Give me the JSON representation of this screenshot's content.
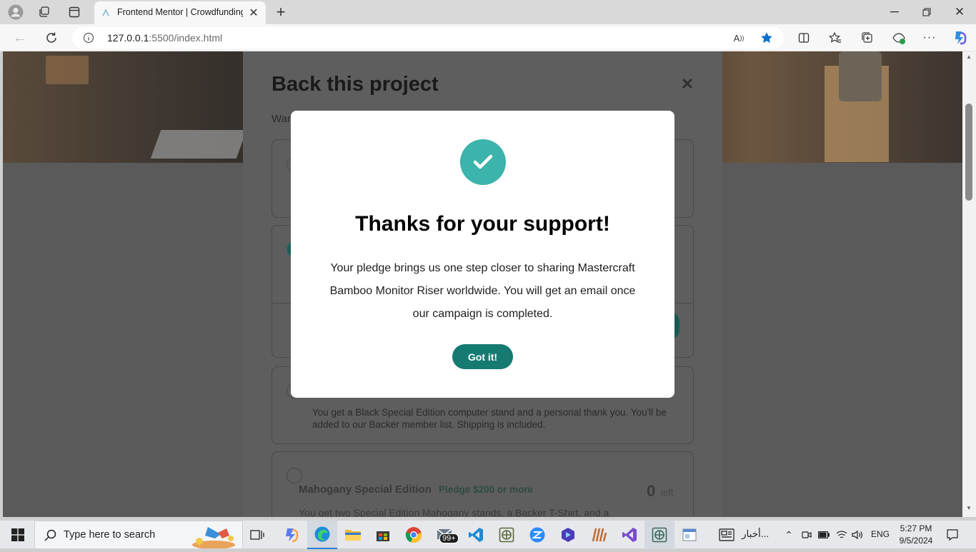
{
  "browser": {
    "tab_title": "Frontend Mentor | Crowdfunding",
    "url": "127.0.0.1:5500/index.html",
    "url_host": "127.0.0.1",
    "url_rest": ":5500/index.html"
  },
  "page": {
    "modal_title": "Back this project",
    "modal_intro": "Want to support us in bringing Mastercraft Bamboo Monitor Riser out in the world?",
    "visible_card_text": "You get a Black Special Edition computer stand and a personal thank you. You'll be added to our Backer member list. Shipping is included.",
    "mahogany_title": "Mahogany Special Edition",
    "mahogany_pledge": "Pledge $200 or more",
    "mahogany_left_num": "0",
    "mahogany_left_label": "left",
    "mahogany_desc": "You get two Special Edition Mahogany stands, a Backer T-Shirt, and a"
  },
  "success": {
    "title": "Thanks for your support!",
    "body": "Your pledge brings us one step closer to sharing Mastercraft Bamboo Monitor Riser worldwide. You will get an email once our campaign is completed.",
    "button": "Got it!"
  },
  "taskbar": {
    "search_placeholder": "Type here to search",
    "news_label": "أخبار...",
    "language": "ENG",
    "time": "5:27 PM",
    "date": "9/5/2024",
    "mail_badge": "99+"
  },
  "colors": {
    "accent": "#157a72",
    "check_circle": "#3cb3ab",
    "edge_blue": "#0c6fd1"
  }
}
